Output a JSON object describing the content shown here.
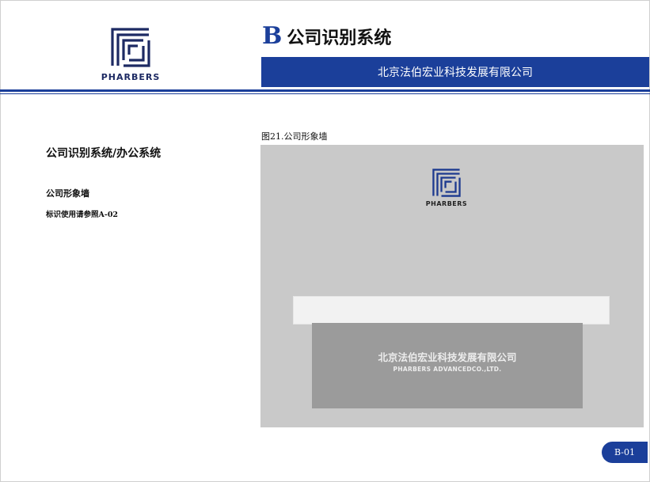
{
  "header": {
    "logo_text": "PHARBERS",
    "section_letter": "B",
    "section_title": "公司识别系统",
    "company_name": "北京法伯宏业科技发展有限公司"
  },
  "left": {
    "section_title": "公司识别系统/办公系统",
    "item_title": "公司形象墙",
    "item_note": "标识使用请参照A-02"
  },
  "figure": {
    "caption": "图21.公司形象墙",
    "logo_text": "PHARBERS",
    "panel_cn": "北京法伯宏业科技发展有限公司",
    "panel_en": "PHARBERS ADVANCEDCO.,LTD."
  },
  "page_number": "B-01",
  "colors": {
    "brand_blue": "#1b3f9a",
    "wall_gray": "#c9c9c9",
    "panel_gray": "#9b9b9b"
  }
}
